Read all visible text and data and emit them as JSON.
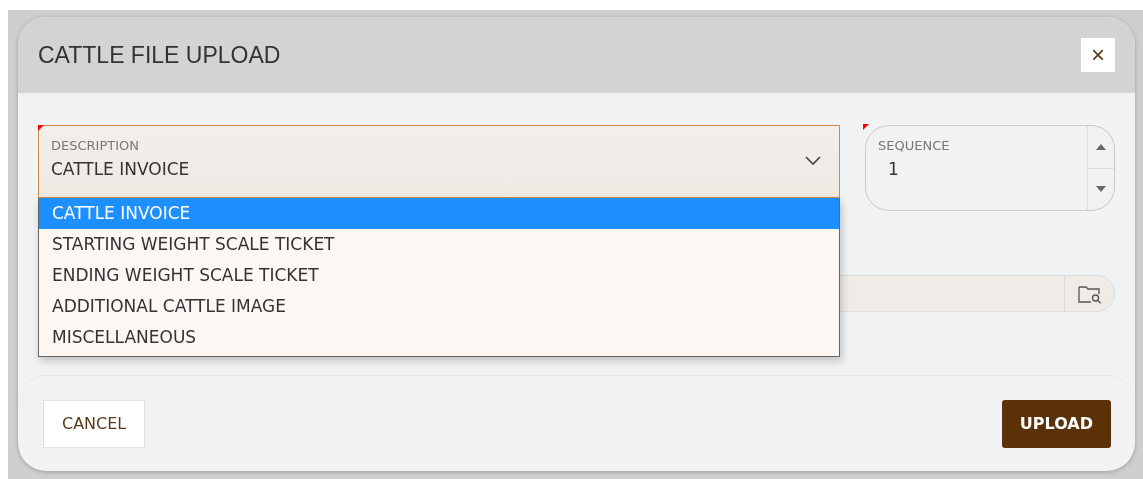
{
  "dialog": {
    "title": "CATTLE FILE UPLOAD",
    "close": "×"
  },
  "description": {
    "label": "DESCRIPTION",
    "value": "CATTLE INVOICE",
    "required": true,
    "expanded": true,
    "options": [
      {
        "label": "CATTLE INVOICE",
        "selected": true
      },
      {
        "label": "STARTING WEIGHT SCALE TICKET",
        "selected": false
      },
      {
        "label": "ENDING WEIGHT SCALE TICKET",
        "selected": false
      },
      {
        "label": "ADDITIONAL CATTLE IMAGE",
        "selected": false
      },
      {
        "label": "MISCELLANEOUS",
        "selected": false
      }
    ]
  },
  "sequence": {
    "label": "SEQUENCE",
    "value": "1",
    "required": true
  },
  "buttons": {
    "cancel": "CANCEL",
    "upload": "UPLOAD"
  }
}
